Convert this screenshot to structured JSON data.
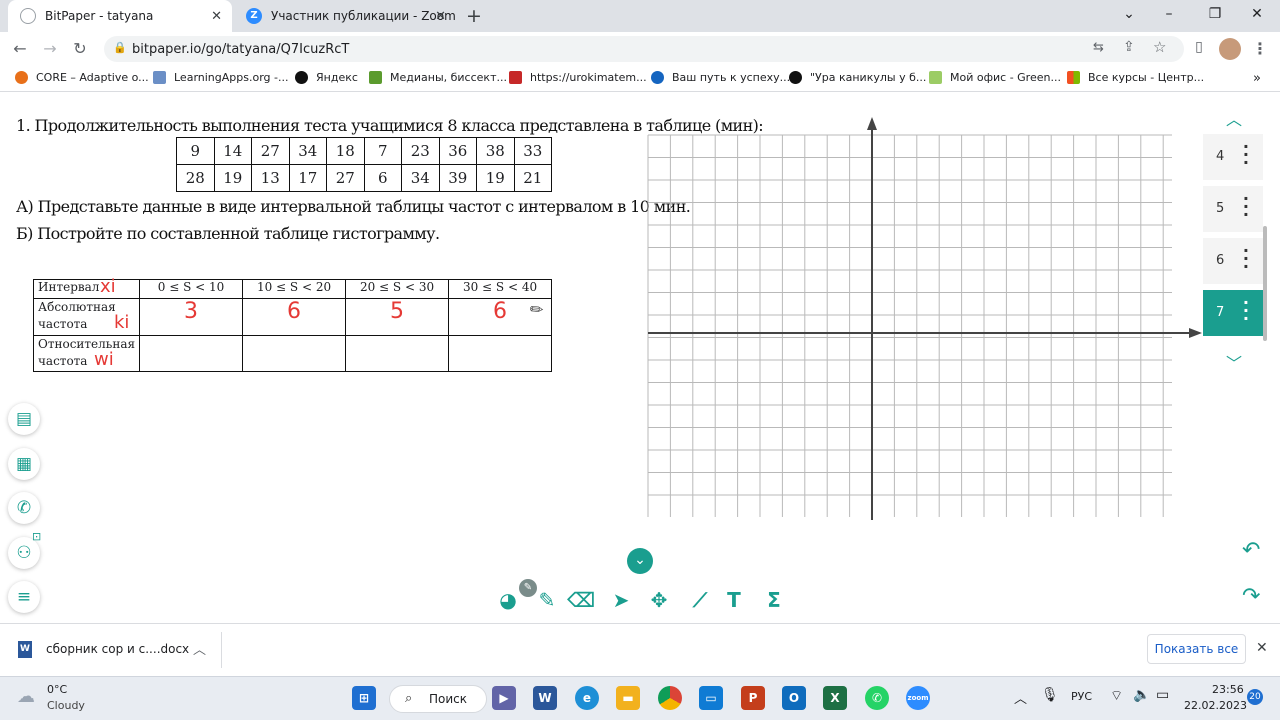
{
  "tabs": [
    {
      "title": "BitPaper - tatyana",
      "active": true
    },
    {
      "title": "Участник публикации - Zoom",
      "active": false
    }
  ],
  "address": {
    "url": "bitpaper.io/go/tatyana/Q7IcuzRcT"
  },
  "bookmarks": [
    "CORE – Adaptive o...",
    "LearningApps.org -...",
    "Яндекс",
    "Медианы, биссект...",
    "https://urokimatem...",
    "Ваш путь к успеху...",
    "\"Ура каникулы у б...",
    "Мой офис - Green...",
    "Все курсы - Центр..."
  ],
  "task": {
    "title": "1. Продолжительность выполнения теста учащимися 8 класса представлена в таблице (мин):",
    "data_rows": [
      [
        "9",
        "14",
        "27",
        "34",
        "18",
        "7",
        "23",
        "36",
        "38",
        "33"
      ],
      [
        "28",
        "19",
        "13",
        "17",
        "27",
        "6",
        "34",
        "39",
        "19",
        "21"
      ]
    ],
    "part_a": "А) Представьте данные в виде интервальной таблицы частот с интервалом в 10 мин.",
    "part_b": "Б) Постройте по составленной таблице гистограмму."
  },
  "freq_table": {
    "row1_label": "Интервал",
    "row1_note": "xi",
    "intervals": [
      "0 ≤ S < 10",
      "10 ≤ S < 20",
      "20 ≤ S < 30",
      "30 ≤ S < 40"
    ],
    "row2_label_1": "Абсолютная",
    "row2_label_2": "частота",
    "row2_note": "ki",
    "abs_freq": [
      "3",
      "6",
      "5",
      "6"
    ],
    "row3_label_1": "Относительная",
    "row3_label_2": "частота",
    "row3_note": "wi"
  },
  "page_nav": [
    "4",
    "5",
    "6",
    "7"
  ],
  "page_nav_selected": "7",
  "accent": "#1a9e8f",
  "download": {
    "file": "сборник сор и с....docx",
    "show_all": "Показать все"
  },
  "taskbar": {
    "weather_temp": "0°C",
    "weather_desc": "Cloudy",
    "search": "Поиск",
    "lang": "РУС",
    "time": "23:56",
    "date": "22.02.2023",
    "badge": "20"
  }
}
